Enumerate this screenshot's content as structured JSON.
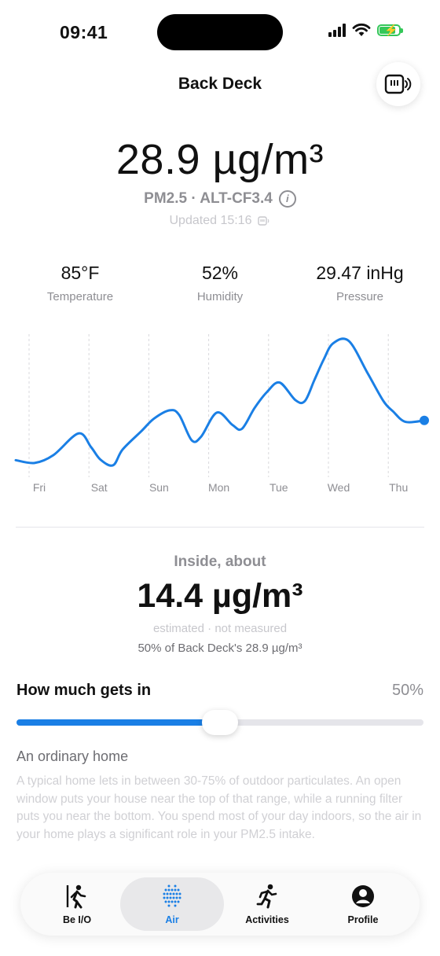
{
  "status_bar": {
    "time": "09:41"
  },
  "header": {
    "title": "Back Deck"
  },
  "reading": {
    "value": "28.9 µg/m³",
    "subtitle": "PM2.5 · ALT-CF3.4",
    "updated": "Updated 15:16"
  },
  "stats": [
    {
      "value": "85°F",
      "label": "Temperature"
    },
    {
      "value": "52%",
      "label": "Humidity"
    },
    {
      "value": "29.47 inHg",
      "label": "Pressure"
    }
  ],
  "chart_data": {
    "type": "line",
    "categories": [
      "Fri",
      "Sat",
      "Sun",
      "Mon",
      "Tue",
      "Wed",
      "Thu"
    ],
    "x": [
      0,
      0.3,
      0.6,
      1.0,
      1.2,
      1.35,
      1.55,
      1.7,
      2.0,
      2.2,
      2.45,
      2.6,
      2.8,
      2.95,
      3.2,
      3.45,
      3.6,
      3.8,
      4.0,
      4.2,
      4.45,
      4.6,
      4.75,
      4.9,
      5.05,
      5.3,
      5.6,
      5.85,
      6.0,
      6.2,
      6.5
    ],
    "values": [
      4.2,
      3.6,
      5.3,
      10.0,
      7.0,
      4.3,
      3.1,
      6.5,
      10.5,
      13.2,
      15.0,
      14.0,
      8.5,
      9.3,
      14.5,
      11.8,
      11.0,
      15.5,
      19.0,
      21.0,
      17.2,
      17.0,
      21.5,
      26.0,
      29.5,
      30.0,
      23.0,
      17.0,
      14.8,
      12.5,
      12.8
    ],
    "ylim": [
      0,
      32
    ],
    "grid": "vertical",
    "line_color": "#1a7fe5"
  },
  "inside": {
    "label": "Inside, about",
    "value": "14.4 µg/m³",
    "estimated": "estimated · not measured",
    "percent_of": "50% of Back Deck's 28.9 µg/m³"
  },
  "infiltration": {
    "label": "How much gets in",
    "value_text": "50%",
    "value": 0.5,
    "home_type": "An ordinary home",
    "description": "A typical home lets in between 30-75% of outdoor particulates. An open window puts your house near the top of that range, while a running filter puts you near the bottom. You spend most of your day indoors, so the air in your home plays a significant role in your PM2.5 intake."
  },
  "tabbar": [
    {
      "label": "Be I/O",
      "icon": "person-walking-door-icon"
    },
    {
      "label": "Air",
      "icon": "dots-sphere-icon",
      "active": true
    },
    {
      "label": "Activities",
      "icon": "running-person-icon"
    },
    {
      "label": "Profile",
      "icon": "profile-icon"
    }
  ],
  "colors": {
    "accent": "#1a7fe5",
    "battery": "#34c759"
  }
}
